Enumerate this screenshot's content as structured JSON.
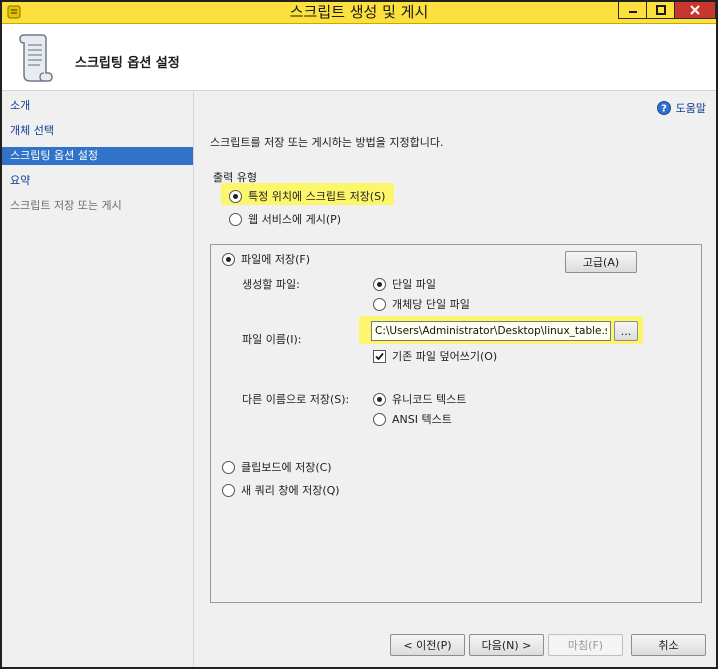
{
  "window": {
    "title": "스크립트 생성 및 게시"
  },
  "header": {
    "title": "스크립팅 옵션 설정"
  },
  "nav": {
    "items": [
      {
        "label": "소개"
      },
      {
        "label": "개체 선택"
      },
      {
        "label": "스크립팅 옵션 설정"
      },
      {
        "label": "요약"
      },
      {
        "label": "스크립트 저장 또는 게시"
      }
    ]
  },
  "help": {
    "label": "도움말"
  },
  "description": "스크립트를 저장 또는 게시하는 방법을 지정합니다.",
  "output_type": {
    "label": "출력 유형",
    "save_to_location": "특정 위치에 스크립트 저장(S)",
    "publish_web": "웹 서비스에 게시(P)"
  },
  "save_to_file": {
    "label": "파일에 저장(F)",
    "advanced_label": "고급(A)",
    "files_to_generate_label": "생성할 파일:",
    "single_file": "단일 파일",
    "file_per_object": "개체당 단일 파일",
    "file_name_label": "파일 이름(I):",
    "file_name_value": "C:\\Users\\Administrator\\Desktop\\linux_table.sql",
    "browse_label": "...",
    "overwrite_label": "기존 파일 덮어쓰기(O)",
    "save_as_label": "다른 이름으로 저장(S):",
    "unicode_text": "유니코드 텍스트",
    "ansi_text": "ANSI 텍스트"
  },
  "clipboard_label": "클립보드에 저장(C)",
  "query_window_label": "새 쿼리 창에 저장(Q)",
  "footer": {
    "prev": "< 이전(P)",
    "next": "다음(N) >",
    "finish": "마침(F)",
    "cancel": "취소"
  },
  "colors": {
    "title_bar": "#fce03d",
    "highlight": "#fdf56b",
    "nav_selected": "#3173c9",
    "close_button": "#c7372f"
  }
}
